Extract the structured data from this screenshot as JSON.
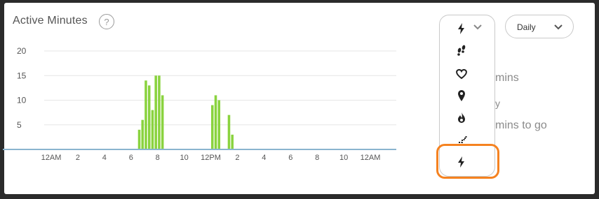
{
  "card": {
    "title": "Active Minutes",
    "help_label": "?"
  },
  "summary": {
    "line1": "mins",
    "line2": "y",
    "line3": "mins to go"
  },
  "period_select": {
    "selected": "Daily"
  },
  "metric_menu": {
    "selected_icon": "lightning-bolt-icon",
    "items": [
      {
        "icon": "footsteps-icon"
      },
      {
        "icon": "heart-icon"
      },
      {
        "icon": "location-pin-icon"
      },
      {
        "icon": "flame-icon"
      },
      {
        "icon": "stairs-icon"
      },
      {
        "icon": "lightning-bolt-icon",
        "highlighted": true
      }
    ]
  },
  "colors": {
    "bar": "#8ad33f",
    "grid": "#e6e6e6",
    "axis": "#8ab4cf",
    "highlight": "#f58220"
  },
  "chart_data": {
    "type": "bar",
    "title": "",
    "xlabel": "",
    "ylabel": "",
    "ylim": [
      0,
      20
    ],
    "yticks": [
      5,
      10,
      15,
      20
    ],
    "xlim": [
      0,
      24
    ],
    "xticks": [
      {
        "hour": 0,
        "label": "12AM"
      },
      {
        "hour": 2,
        "label": "2"
      },
      {
        "hour": 4,
        "label": "4"
      },
      {
        "hour": 6,
        "label": "6"
      },
      {
        "hour": 8,
        "label": "8"
      },
      {
        "hour": 10,
        "label": "10"
      },
      {
        "hour": 12,
        "label": "12PM"
      },
      {
        "hour": 14,
        "label": "2"
      },
      {
        "hour": 16,
        "label": "4"
      },
      {
        "hour": 18,
        "label": "6"
      },
      {
        "hour": 20,
        "label": "8"
      },
      {
        "hour": 22,
        "label": "10"
      },
      {
        "hour": 24,
        "label": "12AM"
      }
    ],
    "interval_minutes": 15,
    "bars": [
      {
        "time": "6:30",
        "value": 4
      },
      {
        "time": "6:45",
        "value": 6
      },
      {
        "time": "7:00",
        "value": 14
      },
      {
        "time": "7:15",
        "value": 13
      },
      {
        "time": "7:30",
        "value": 8
      },
      {
        "time": "7:45",
        "value": 15
      },
      {
        "time": "8:00",
        "value": 15
      },
      {
        "time": "8:15",
        "value": 11
      },
      {
        "time": "12:00",
        "value": 9
      },
      {
        "time": "12:15",
        "value": 11
      },
      {
        "time": "12:30",
        "value": 10
      },
      {
        "time": "13:15",
        "value": 7
      },
      {
        "time": "13:30",
        "value": 3
      }
    ]
  }
}
